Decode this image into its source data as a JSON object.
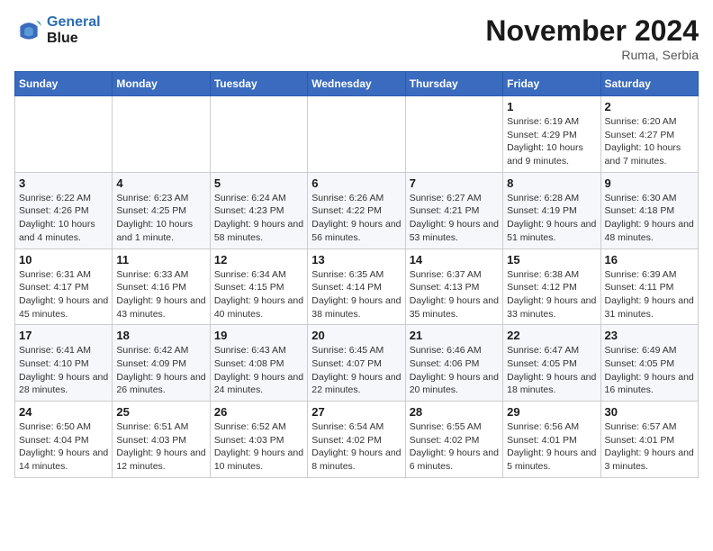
{
  "logo": {
    "line1": "General",
    "line2": "Blue"
  },
  "title": "November 2024",
  "location": "Ruma, Serbia",
  "days_of_week": [
    "Sunday",
    "Monday",
    "Tuesday",
    "Wednesday",
    "Thursday",
    "Friday",
    "Saturday"
  ],
  "weeks": [
    [
      {
        "day": "",
        "info": ""
      },
      {
        "day": "",
        "info": ""
      },
      {
        "day": "",
        "info": ""
      },
      {
        "day": "",
        "info": ""
      },
      {
        "day": "",
        "info": ""
      },
      {
        "day": "1",
        "info": "Sunrise: 6:19 AM\nSunset: 4:29 PM\nDaylight: 10 hours and 9 minutes."
      },
      {
        "day": "2",
        "info": "Sunrise: 6:20 AM\nSunset: 4:27 PM\nDaylight: 10 hours and 7 minutes."
      }
    ],
    [
      {
        "day": "3",
        "info": "Sunrise: 6:22 AM\nSunset: 4:26 PM\nDaylight: 10 hours and 4 minutes."
      },
      {
        "day": "4",
        "info": "Sunrise: 6:23 AM\nSunset: 4:25 PM\nDaylight: 10 hours and 1 minute."
      },
      {
        "day": "5",
        "info": "Sunrise: 6:24 AM\nSunset: 4:23 PM\nDaylight: 9 hours and 58 minutes."
      },
      {
        "day": "6",
        "info": "Sunrise: 6:26 AM\nSunset: 4:22 PM\nDaylight: 9 hours and 56 minutes."
      },
      {
        "day": "7",
        "info": "Sunrise: 6:27 AM\nSunset: 4:21 PM\nDaylight: 9 hours and 53 minutes."
      },
      {
        "day": "8",
        "info": "Sunrise: 6:28 AM\nSunset: 4:19 PM\nDaylight: 9 hours and 51 minutes."
      },
      {
        "day": "9",
        "info": "Sunrise: 6:30 AM\nSunset: 4:18 PM\nDaylight: 9 hours and 48 minutes."
      }
    ],
    [
      {
        "day": "10",
        "info": "Sunrise: 6:31 AM\nSunset: 4:17 PM\nDaylight: 9 hours and 45 minutes."
      },
      {
        "day": "11",
        "info": "Sunrise: 6:33 AM\nSunset: 4:16 PM\nDaylight: 9 hours and 43 minutes."
      },
      {
        "day": "12",
        "info": "Sunrise: 6:34 AM\nSunset: 4:15 PM\nDaylight: 9 hours and 40 minutes."
      },
      {
        "day": "13",
        "info": "Sunrise: 6:35 AM\nSunset: 4:14 PM\nDaylight: 9 hours and 38 minutes."
      },
      {
        "day": "14",
        "info": "Sunrise: 6:37 AM\nSunset: 4:13 PM\nDaylight: 9 hours and 35 minutes."
      },
      {
        "day": "15",
        "info": "Sunrise: 6:38 AM\nSunset: 4:12 PM\nDaylight: 9 hours and 33 minutes."
      },
      {
        "day": "16",
        "info": "Sunrise: 6:39 AM\nSunset: 4:11 PM\nDaylight: 9 hours and 31 minutes."
      }
    ],
    [
      {
        "day": "17",
        "info": "Sunrise: 6:41 AM\nSunset: 4:10 PM\nDaylight: 9 hours and 28 minutes."
      },
      {
        "day": "18",
        "info": "Sunrise: 6:42 AM\nSunset: 4:09 PM\nDaylight: 9 hours and 26 minutes."
      },
      {
        "day": "19",
        "info": "Sunrise: 6:43 AM\nSunset: 4:08 PM\nDaylight: 9 hours and 24 minutes."
      },
      {
        "day": "20",
        "info": "Sunrise: 6:45 AM\nSunset: 4:07 PM\nDaylight: 9 hours and 22 minutes."
      },
      {
        "day": "21",
        "info": "Sunrise: 6:46 AM\nSunset: 4:06 PM\nDaylight: 9 hours and 20 minutes."
      },
      {
        "day": "22",
        "info": "Sunrise: 6:47 AM\nSunset: 4:05 PM\nDaylight: 9 hours and 18 minutes."
      },
      {
        "day": "23",
        "info": "Sunrise: 6:49 AM\nSunset: 4:05 PM\nDaylight: 9 hours and 16 minutes."
      }
    ],
    [
      {
        "day": "24",
        "info": "Sunrise: 6:50 AM\nSunset: 4:04 PM\nDaylight: 9 hours and 14 minutes."
      },
      {
        "day": "25",
        "info": "Sunrise: 6:51 AM\nSunset: 4:03 PM\nDaylight: 9 hours and 12 minutes."
      },
      {
        "day": "26",
        "info": "Sunrise: 6:52 AM\nSunset: 4:03 PM\nDaylight: 9 hours and 10 minutes."
      },
      {
        "day": "27",
        "info": "Sunrise: 6:54 AM\nSunset: 4:02 PM\nDaylight: 9 hours and 8 minutes."
      },
      {
        "day": "28",
        "info": "Sunrise: 6:55 AM\nSunset: 4:02 PM\nDaylight: 9 hours and 6 minutes."
      },
      {
        "day": "29",
        "info": "Sunrise: 6:56 AM\nSunset: 4:01 PM\nDaylight: 9 hours and 5 minutes."
      },
      {
        "day": "30",
        "info": "Sunrise: 6:57 AM\nSunset: 4:01 PM\nDaylight: 9 hours and 3 minutes."
      }
    ]
  ]
}
